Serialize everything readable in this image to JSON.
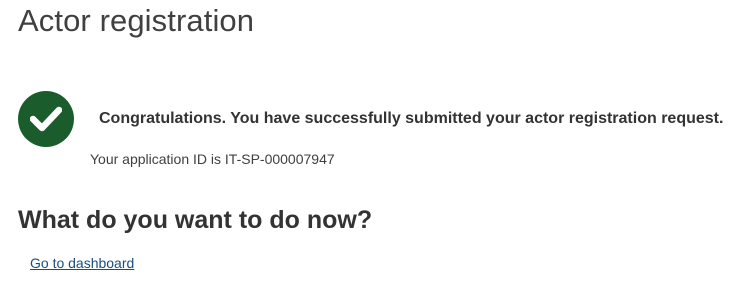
{
  "header": {
    "title": "Actor registration"
  },
  "confirmation": {
    "icon": "check-circle-icon",
    "icon_color": "#1a5c2c",
    "message": "Congratulations. You have successfully submitted your actor registration request.",
    "application_id_text": "Your application ID is IT-SP-000007947"
  },
  "next_steps": {
    "heading": "What do you want to do now?",
    "links": [
      {
        "label": "Go to dashboard"
      }
    ]
  },
  "colors": {
    "text": "#404040",
    "link": "#1a4e80",
    "success": "#1a5c2c"
  }
}
